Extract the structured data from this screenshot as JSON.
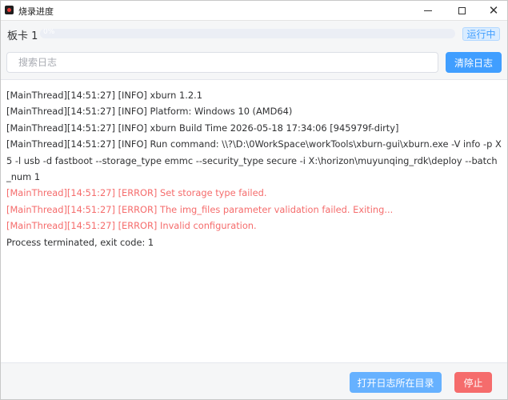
{
  "window": {
    "title": "烧录进度",
    "minimize_icon": "minimize-icon",
    "maximize_icon": "maximize-icon",
    "close_glyph": "✕"
  },
  "board": {
    "label": "板卡 1",
    "progress_percent": 0,
    "progress_text": "0%",
    "status": "运行中"
  },
  "search": {
    "placeholder": "搜索日志",
    "value": ""
  },
  "toolbar": {
    "clear_label": "清除日志"
  },
  "log": {
    "lines": [
      {
        "text": "[MainThread][14:51:27] [INFO] xburn 1.2.1",
        "level": "info"
      },
      {
        "text": "[MainThread][14:51:27] [INFO] Platform: Windows 10 (AMD64)",
        "level": "info"
      },
      {
        "text": "[MainThread][14:51:27] [INFO] xburn Build Time 2026-05-18 17:34:06 [945979f-dirty]",
        "level": "info"
      },
      {
        "text": "[MainThread][14:51:27] [INFO] Run command: \\\\?\\D:\\0WorkSpace\\workTools\\xburn-gui\\xburn.exe -V info -p X5 -l usb -d fastboot --storage_type emmc --security_type secure -i X:\\horizon\\muyunqing_rdk\\deploy --batch_num 1",
        "level": "info"
      },
      {
        "text": "[MainThread][14:51:27] [ERROR] Set storage type failed.",
        "level": "error"
      },
      {
        "text": "[MainThread][14:51:27] [ERROR] The img_files parameter validation failed. Exiting...",
        "level": "error"
      },
      {
        "text": "[MainThread][14:51:27] [ERROR] Invalid configuration.",
        "level": "error"
      },
      {
        "text": "Process terminated, exit code: 1",
        "level": "info"
      }
    ]
  },
  "footer": {
    "open_dir_label": "打开日志所在目录",
    "stop_label": "停止"
  },
  "colors": {
    "primary": "#409eff",
    "danger": "#f56c6c",
    "status_bg": "#d9ecff"
  }
}
